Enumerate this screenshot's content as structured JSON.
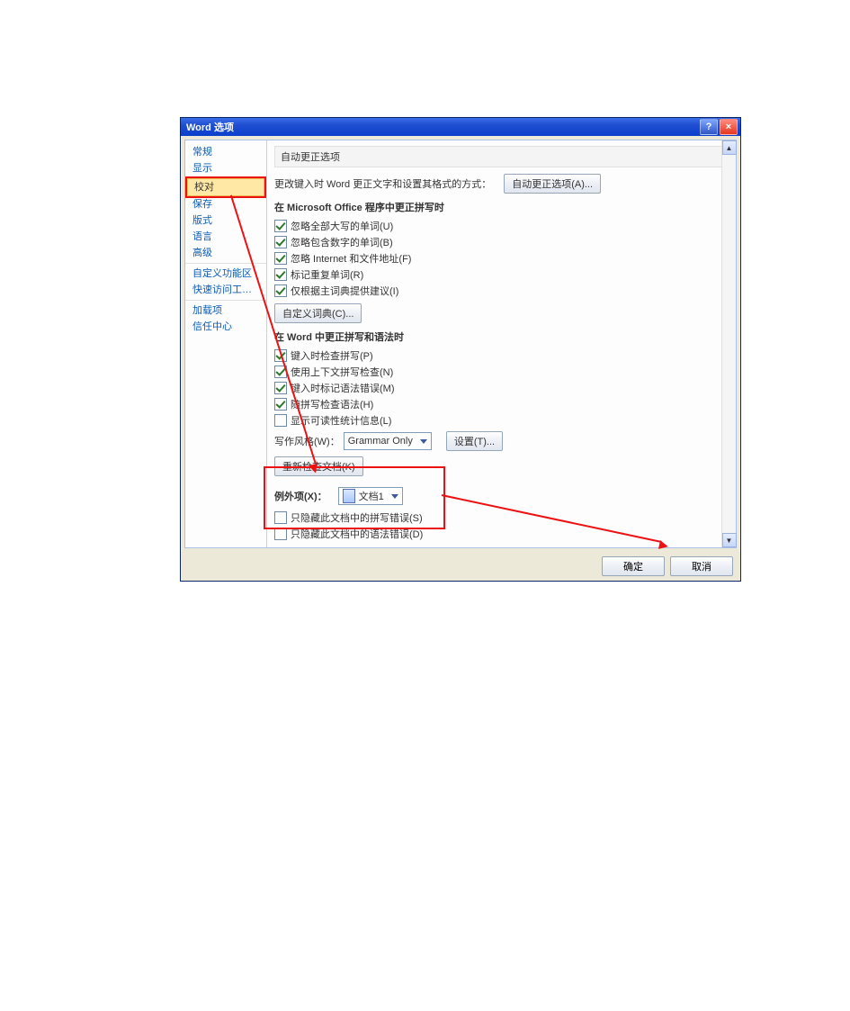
{
  "window": {
    "title": "Word 选项",
    "help": "?",
    "close": "×"
  },
  "sidebar": {
    "items": [
      "常规",
      "显示",
      "校对",
      "保存",
      "版式",
      "语言",
      "高级",
      "自定义功能区",
      "快速访问工具栏",
      "加载项",
      "信任中心"
    ],
    "selected_index": 2
  },
  "autocorrect": {
    "group_title": "自动更正选项",
    "desc": "更改键入时 Word 更正文字和设置其格式的方式：",
    "button": "自动更正选项(A)..."
  },
  "office_spell": {
    "title": "在 Microsoft Office 程序中更正拼写时",
    "items": [
      {
        "label": "忽略全部大写的单词(U)",
        "checked": true
      },
      {
        "label": "忽略包含数字的单词(B)",
        "checked": true
      },
      {
        "label": "忽略 Internet 和文件地址(F)",
        "checked": true
      },
      {
        "label": "标记重复单词(R)",
        "checked": true
      },
      {
        "label": "仅根据主词典提供建议(I)",
        "checked": true
      }
    ],
    "dict_button": "自定义词典(C)..."
  },
  "word_spell": {
    "title": "在 Word 中更正拼写和语法时",
    "items": [
      {
        "label": "键入时检查拼写(P)",
        "checked": true
      },
      {
        "label": "使用上下文拼写检查(N)",
        "checked": true
      },
      {
        "label": "键入时标记语法错误(M)",
        "checked": true
      },
      {
        "label": "随拼写检查语法(H)",
        "checked": true
      },
      {
        "label": "显示可读性统计信息(L)",
        "checked": false
      }
    ],
    "style_label": "写作风格(W)：",
    "style_value": "Grammar Only",
    "settings_button": "设置(T)...",
    "recheck_button": "重新检查文档(K)"
  },
  "exceptions": {
    "label": "例外项(X)：",
    "doc_value": "文档1",
    "items": [
      {
        "label": "只隐藏此文档中的拼写错误(S)",
        "checked": false
      },
      {
        "label": "只隐藏此文档中的语法错误(D)",
        "checked": false
      }
    ]
  },
  "footer": {
    "ok": "确定",
    "cancel": "取消"
  }
}
